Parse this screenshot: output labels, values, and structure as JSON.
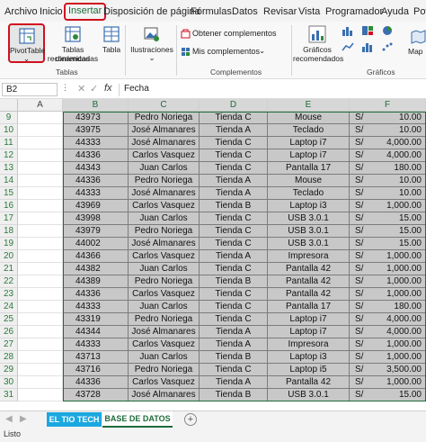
{
  "menu": {
    "tabs": [
      "Archivo",
      "Inicio",
      "Insertar",
      "Disposición de página",
      "Fórmulas",
      "Datos",
      "Revisar",
      "Vista",
      "Programador",
      "Ayuda",
      "Pow"
    ],
    "active": "Insertar"
  },
  "ribbon": {
    "pivot_label": "PivotTable",
    "tablas_dinamicas_line1": "Tablas dinámicas",
    "tablas_dinamicas_line2": "recomendadas",
    "tabla_label": "Tabla",
    "tablas_group": "Tablas",
    "ilustraciones_label": "Ilustraciones",
    "obtener_complementos": "Obtener complementos",
    "mis_complementos": "Mis complementos",
    "complementos_group": "Complementos",
    "graficos_recomendados_line1": "Gráficos",
    "graficos_recomendados_line2": "recomendados",
    "mapas_label": "Map",
    "graficos_group": "Gráficos",
    "accent": "#1e6b3a",
    "highlight": "#d0101e"
  },
  "formula_bar": {
    "name_box": "B2",
    "fx": "fx",
    "value": "Fecha"
  },
  "columns": [
    "A",
    "B",
    "C",
    "D",
    "E",
    "F"
  ],
  "rows": [
    {
      "n": "9",
      "id": "43973",
      "name": "Pedro Noriega",
      "store": "Tienda C",
      "product": "Mouse",
      "cur": "S/",
      "amount": "10.00"
    },
    {
      "n": "10",
      "id": "43975",
      "name": "José Almanares",
      "store": "Tienda A",
      "product": "Teclado",
      "cur": "S/",
      "amount": "10.00"
    },
    {
      "n": "11",
      "id": "44333",
      "name": "José Almanares",
      "store": "Tienda C",
      "product": "Laptop i7",
      "cur": "S/",
      "amount": "4,000.00"
    },
    {
      "n": "12",
      "id": "44336",
      "name": "Carlos Vasquez",
      "store": "Tienda C",
      "product": "Laptop i7",
      "cur": "S/",
      "amount": "4,000.00"
    },
    {
      "n": "13",
      "id": "44343",
      "name": "Juan Carlos",
      "store": "Tienda C",
      "product": "Pantalla 17",
      "cur": "S/",
      "amount": "180.00"
    },
    {
      "n": "14",
      "id": "44336",
      "name": "Pedro Noriega",
      "store": "Tienda A",
      "product": "Mouse",
      "cur": "S/",
      "amount": "10.00"
    },
    {
      "n": "15",
      "id": "44333",
      "name": "José Almanares",
      "store": "Tienda A",
      "product": "Teclado",
      "cur": "S/",
      "amount": "10.00"
    },
    {
      "n": "16",
      "id": "43969",
      "name": "Carlos Vasquez",
      "store": "Tienda B",
      "product": "Laptop i3",
      "cur": "S/",
      "amount": "1,000.00"
    },
    {
      "n": "17",
      "id": "43998",
      "name": "Juan Carlos",
      "store": "Tienda C",
      "product": "USB 3.0.1",
      "cur": "S/",
      "amount": "15.00"
    },
    {
      "n": "18",
      "id": "43979",
      "name": "Pedro Noriega",
      "store": "Tienda C",
      "product": "USB 3.0.1",
      "cur": "S/",
      "amount": "15.00"
    },
    {
      "n": "19",
      "id": "44002",
      "name": "José Almanares",
      "store": "Tienda C",
      "product": "USB 3.0.1",
      "cur": "S/",
      "amount": "15.00"
    },
    {
      "n": "20",
      "id": "44366",
      "name": "Carlos Vasquez",
      "store": "Tienda A",
      "product": "Impresora",
      "cur": "S/",
      "amount": "1,000.00"
    },
    {
      "n": "21",
      "id": "44382",
      "name": "Juan Carlos",
      "store": "Tienda C",
      "product": "Pantalla 42",
      "cur": "S/",
      "amount": "1,000.00"
    },
    {
      "n": "22",
      "id": "44389",
      "name": "Pedro Noriega",
      "store": "Tienda B",
      "product": "Pantalla 42",
      "cur": "S/",
      "amount": "1,000.00"
    },
    {
      "n": "23",
      "id": "44336",
      "name": "Carlos Vasquez",
      "store": "Tienda C",
      "product": "Pantalla 42",
      "cur": "S/",
      "amount": "1,000.00"
    },
    {
      "n": "24",
      "id": "44333",
      "name": "Juan Carlos",
      "store": "Tienda C",
      "product": "Pantalla 17",
      "cur": "S/",
      "amount": "180.00"
    },
    {
      "n": "25",
      "id": "43319",
      "name": "Pedro Noriega",
      "store": "Tienda C",
      "product": "Laptop i7",
      "cur": "S/",
      "amount": "4,000.00"
    },
    {
      "n": "26",
      "id": "44344",
      "name": "José Almanares",
      "store": "Tienda A",
      "product": "Laptop i7",
      "cur": "S/",
      "amount": "4,000.00"
    },
    {
      "n": "27",
      "id": "44333",
      "name": "Carlos Vasquez",
      "store": "Tienda A",
      "product": "Impresora",
      "cur": "S/",
      "amount": "1,000.00"
    },
    {
      "n": "28",
      "id": "43713",
      "name": "Juan Carlos",
      "store": "Tienda B",
      "product": "Laptop i3",
      "cur": "S/",
      "amount": "1,000.00"
    },
    {
      "n": "29",
      "id": "43716",
      "name": "Pedro Noriega",
      "store": "Tienda C",
      "product": "Laptop i5",
      "cur": "S/",
      "amount": "3,500.00"
    },
    {
      "n": "30",
      "id": "44336",
      "name": "Carlos Vasquez",
      "store": "Tienda A",
      "product": "Pantalla 42",
      "cur": "S/",
      "amount": "1,000.00"
    },
    {
      "n": "31",
      "id": "43728",
      "name": "José Almanares",
      "store": "Tienda B",
      "product": "USB 3.0.1",
      "cur": "S/",
      "amount": "15.00"
    }
  ],
  "sheets": {
    "tab1": "EL TIO TECH",
    "tab2": "BASE DE DATOS",
    "tab1_color": "#1ba7e0"
  },
  "status": "Listo"
}
